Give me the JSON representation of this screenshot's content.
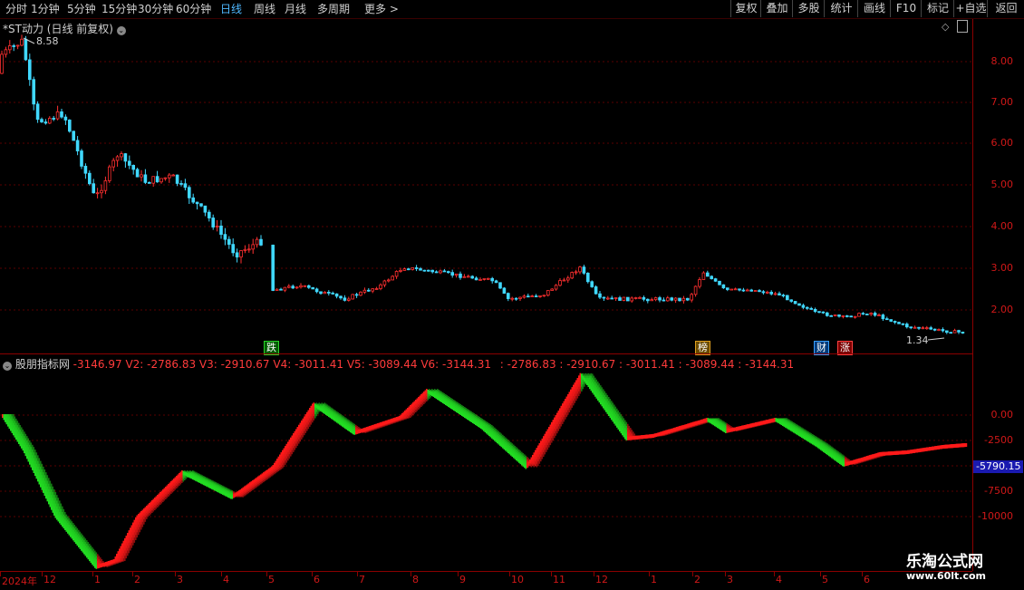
{
  "toolbar": {
    "periods": [
      "分时",
      "1分钟",
      "5分钟",
      "15分钟",
      "30分钟",
      "60分钟",
      "日线",
      "周线",
      "月线",
      "多周期",
      "更多 >"
    ],
    "active_period": "日线",
    "buttons": [
      "复权",
      "叠加",
      "多股",
      "统计",
      "画线",
      "F10",
      "标记",
      "+自选",
      "返回"
    ]
  },
  "main_chart": {
    "title": "*ST动力 (日线 前复权)",
    "high_label": "8.58",
    "low_label": "1.34",
    "y_ticks": [
      "8.00",
      "7.00",
      "6.00",
      "5.00",
      "4.00",
      "3.00",
      "2.00"
    ],
    "markers": [
      {
        "text": "跌",
        "color": "#2bd42b"
      },
      {
        "text": "榜",
        "color": "#e0a020"
      },
      {
        "text": "财",
        "color": "#3aa0ff"
      },
      {
        "text": "涨",
        "color": "#ff4040"
      }
    ]
  },
  "indicator": {
    "name": "股朋指标网",
    "values_line": "-3146.97  V2: -2786.83  V3: -2910.67  V4: -3011.41  V5: -3089.44  V6: -3144.31",
    "values_line2": ": -2786.83   : -2910.67   : -3011.41   : -3089.44   : -3144.31",
    "y_ticks": [
      "0.00",
      "-2500",
      "-5000",
      "-7500",
      "-10000"
    ],
    "current_value": "-5790.15"
  },
  "date_axis": [
    "2024年",
    "12",
    "1",
    "2",
    "3",
    "4",
    "5",
    "6",
    "7",
    "8",
    "9",
    "10",
    "11",
    "12",
    "1",
    "2",
    "3",
    "4",
    "5",
    "6"
  ],
  "watermark": {
    "line1": "乐淘公式网",
    "line2": "www.60lt.com"
  },
  "colors": {
    "up": "#ff3030",
    "down": "#40d8ff",
    "ind_up": "#ff1a1a",
    "ind_down": "#22dd22",
    "grid": "#5a0000",
    "axis": "#d01818"
  },
  "chart_data": {
    "type": "line",
    "title": "*ST动力 (日线 前复权)",
    "ylim": [
      1.0,
      9.0
    ],
    "x": [
      "2024-11",
      "2024-12",
      "2025-01",
      "2025-02",
      "2025-03",
      "2025-04",
      "2025-05",
      "2025-06",
      "2025-07",
      "2025-08",
      "2025-09",
      "2025-10",
      "2025-11",
      "2025-12",
      "2026-01",
      "2026-02",
      "2026-03",
      "2026-04",
      "2026-05",
      "2026-06"
    ],
    "series": [
      {
        "name": "price",
        "values": [
          8.2,
          7.0,
          5.3,
          5.0,
          4.6,
          3.5,
          2.6,
          2.6,
          2.7,
          3.0,
          2.8,
          2.1,
          2.7,
          2.4,
          2.3,
          2.6,
          2.5,
          2.2,
          1.9,
          1.5
        ]
      },
      {
        "name": "indicator",
        "values": [
          -1000,
          -4000,
          -14000,
          -6500,
          -5000,
          -7500,
          -2500,
          500,
          -1500,
          2500,
          -1000,
          -5000,
          3500,
          -2500,
          -1500,
          -1500,
          -2000,
          -4500,
          -3000,
          -2500
        ]
      }
    ]
  }
}
